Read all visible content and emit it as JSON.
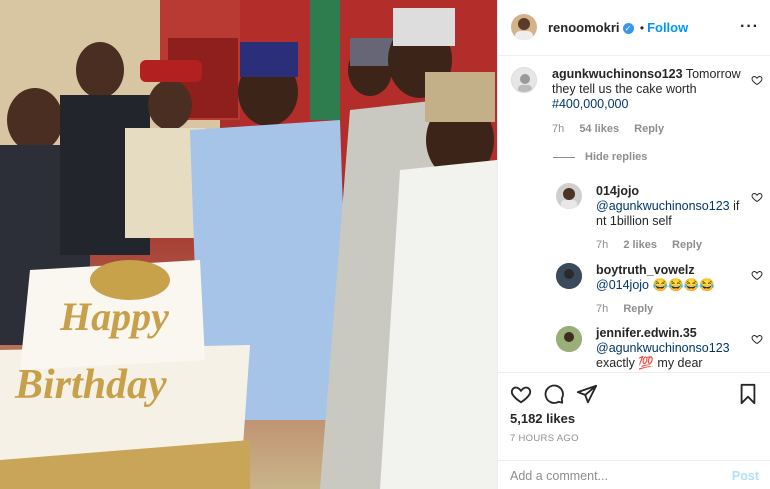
{
  "post": {
    "username": "renoomokri",
    "follow_label": "Follow",
    "more_icon": "more-options-icon"
  },
  "photo": {
    "cake_text_line1": "Happy",
    "cake_text_line2": "Birthday"
  },
  "comments": [
    {
      "username": "agunkwuchinonso123",
      "text_pre": "Tomorrow they tell us the cake worth ",
      "hashtag": "#400,000,000",
      "time": "7h",
      "likes": "54 likes",
      "reply": "Reply"
    }
  ],
  "hide_replies_label": "Hide replies",
  "replies": [
    {
      "username": "014jojo",
      "mention": "@agunkwuchinonso123",
      "text": " if nt 1billion self",
      "time": "7h",
      "likes": "2 likes",
      "reply": "Reply"
    },
    {
      "username": "boytruth_vowelz",
      "mention": "@014jojo",
      "text": " 😂😂😂😂",
      "time": "7h",
      "reply": "Reply"
    },
    {
      "username": "jennifer.edwin.35",
      "mention": "@agunkwuchinonso123",
      "text": "exactly 💯 my dear"
    }
  ],
  "footer": {
    "likes": "5,182 likes",
    "time_ago": "7 HOURS AGO",
    "add_comment_placeholder": "Add a comment...",
    "post_label": "Post"
  }
}
